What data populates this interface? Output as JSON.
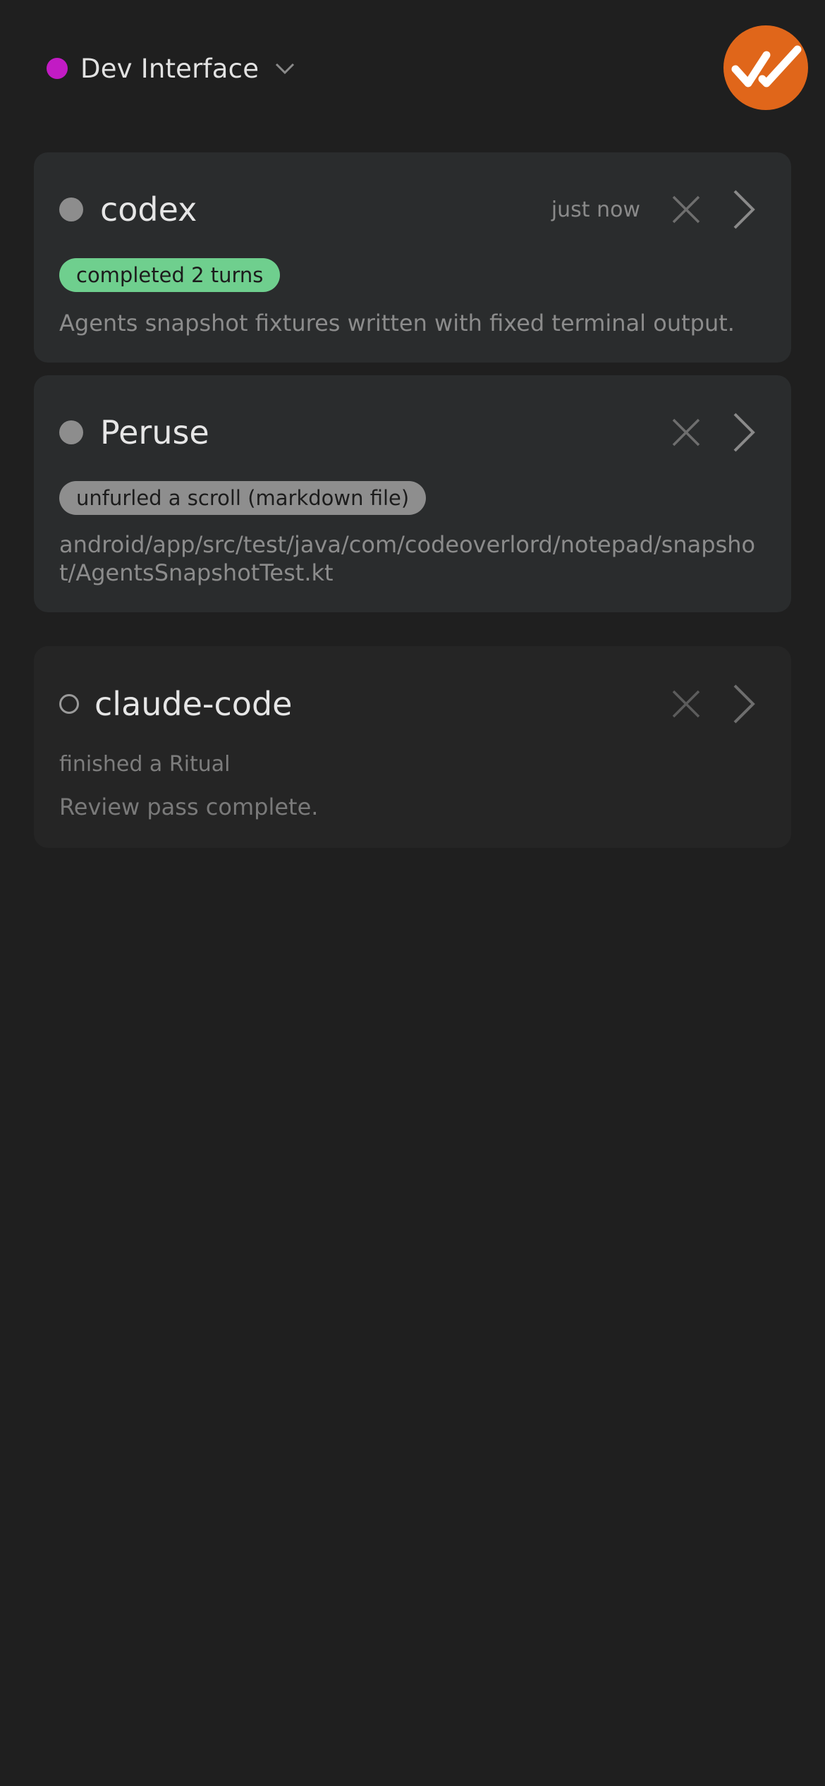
{
  "header": {
    "workspace_name": "Dev Interface",
    "workspace_color": "#c21bc4",
    "logo_color": "#e0661a",
    "logo_icon": "double-check-icon"
  },
  "agents": [
    {
      "name": "codex",
      "timestamp": "just now",
      "badge": "completed 2 turns",
      "badge_color": "#6fcf8e",
      "text": "Agents snapshot fixtures written with fixed terminal output."
    },
    {
      "name": "Peruse",
      "badge": "unfurled a scroll (markdown file)",
      "badge_color": "#8e8e8e",
      "text": "android/app/src/test/java/com/codeoverlord/notepad/snapshot/AgentsSnapshotTest.kt"
    },
    {
      "name": "claude-code",
      "status_line": "finished a Ritual",
      "text": "Review pass complete."
    }
  ]
}
